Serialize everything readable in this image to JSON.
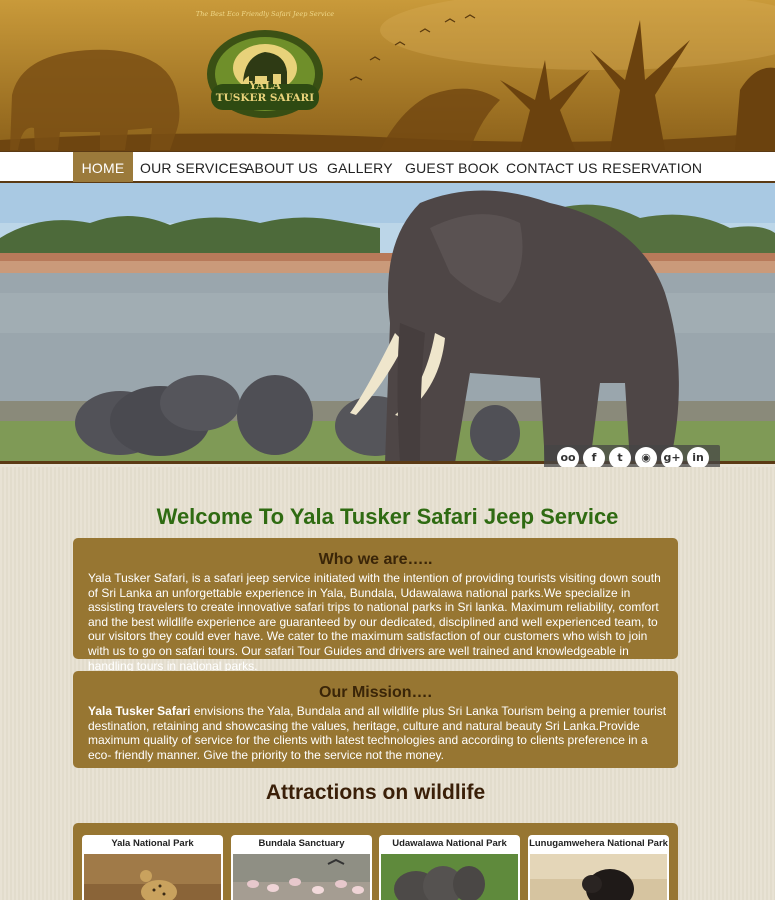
{
  "logo": {
    "arc_text": "The Best Eco Friendly Safari Jeep Service",
    "name_line1": "YALA",
    "name_line2": "TUSKER SAFARI"
  },
  "nav": {
    "items": [
      "HOME",
      "OUR SERVICES",
      "ABOUT US",
      "GALLERY",
      "GUEST BOOK",
      "CONTACT US",
      "RESERVATION"
    ],
    "active": "HOME"
  },
  "social": {
    "icons": [
      "tripadvisor-icon",
      "facebook-icon",
      "twitter-icon",
      "rss-icon",
      "google-plus-icon",
      "linkedin-icon"
    ],
    "glyphs": [
      "oo",
      "f",
      "t",
      "◉",
      "g+",
      "in"
    ]
  },
  "welcome": "Welcome To Yala Tusker Safari Jeep Service",
  "who": {
    "title": "Who we are…..",
    "text": "Yala Tusker Safari, is a safari jeep service initiated with the intention of providing tourists visiting down south of Sri Lanka an unforgettable experience in Yala, Bundala, Udawalawa national parks.We specialize in assisting travelers to create innovative safari trips to national parks in Sri lanka. Maximum reliability, comfort and the best wildlife experience are guaranteed by our dedicated, disciplined and well experienced team, to our visitors they could ever have. We cater to the maximum satisfaction of our customers who wish to join with us to go on safari tours. Our safari Tour Guides and drivers are well trained and knowledgeable in handling tours in national parks."
  },
  "mission": {
    "title": "Our Mission….",
    "bold": "Yala Tusker Safari",
    "text": " envisions the Yala, Bundala and all wildlife plus Sri Lanka Tourism being a premier tourist destination, retaining and showcasing the values, heritage, culture and natural beauty Sri Lanka.Provide maximum quality of service for the clients with latest technologies and according to clients preference in a eco- friendly manner. Give the priority to the service not the money."
  },
  "attractions": {
    "title": "Attractions on wildlife",
    "cards": [
      "Yala National Park",
      "Bundala Sanctuary",
      "Udawalawa National Park",
      "Lunugamwehera National Park"
    ]
  },
  "colors": {
    "accent_green": "#2f6b12",
    "box_brown": "#977632",
    "nav_active": "#9b7a3b",
    "header_gold": "#b88a2e"
  }
}
